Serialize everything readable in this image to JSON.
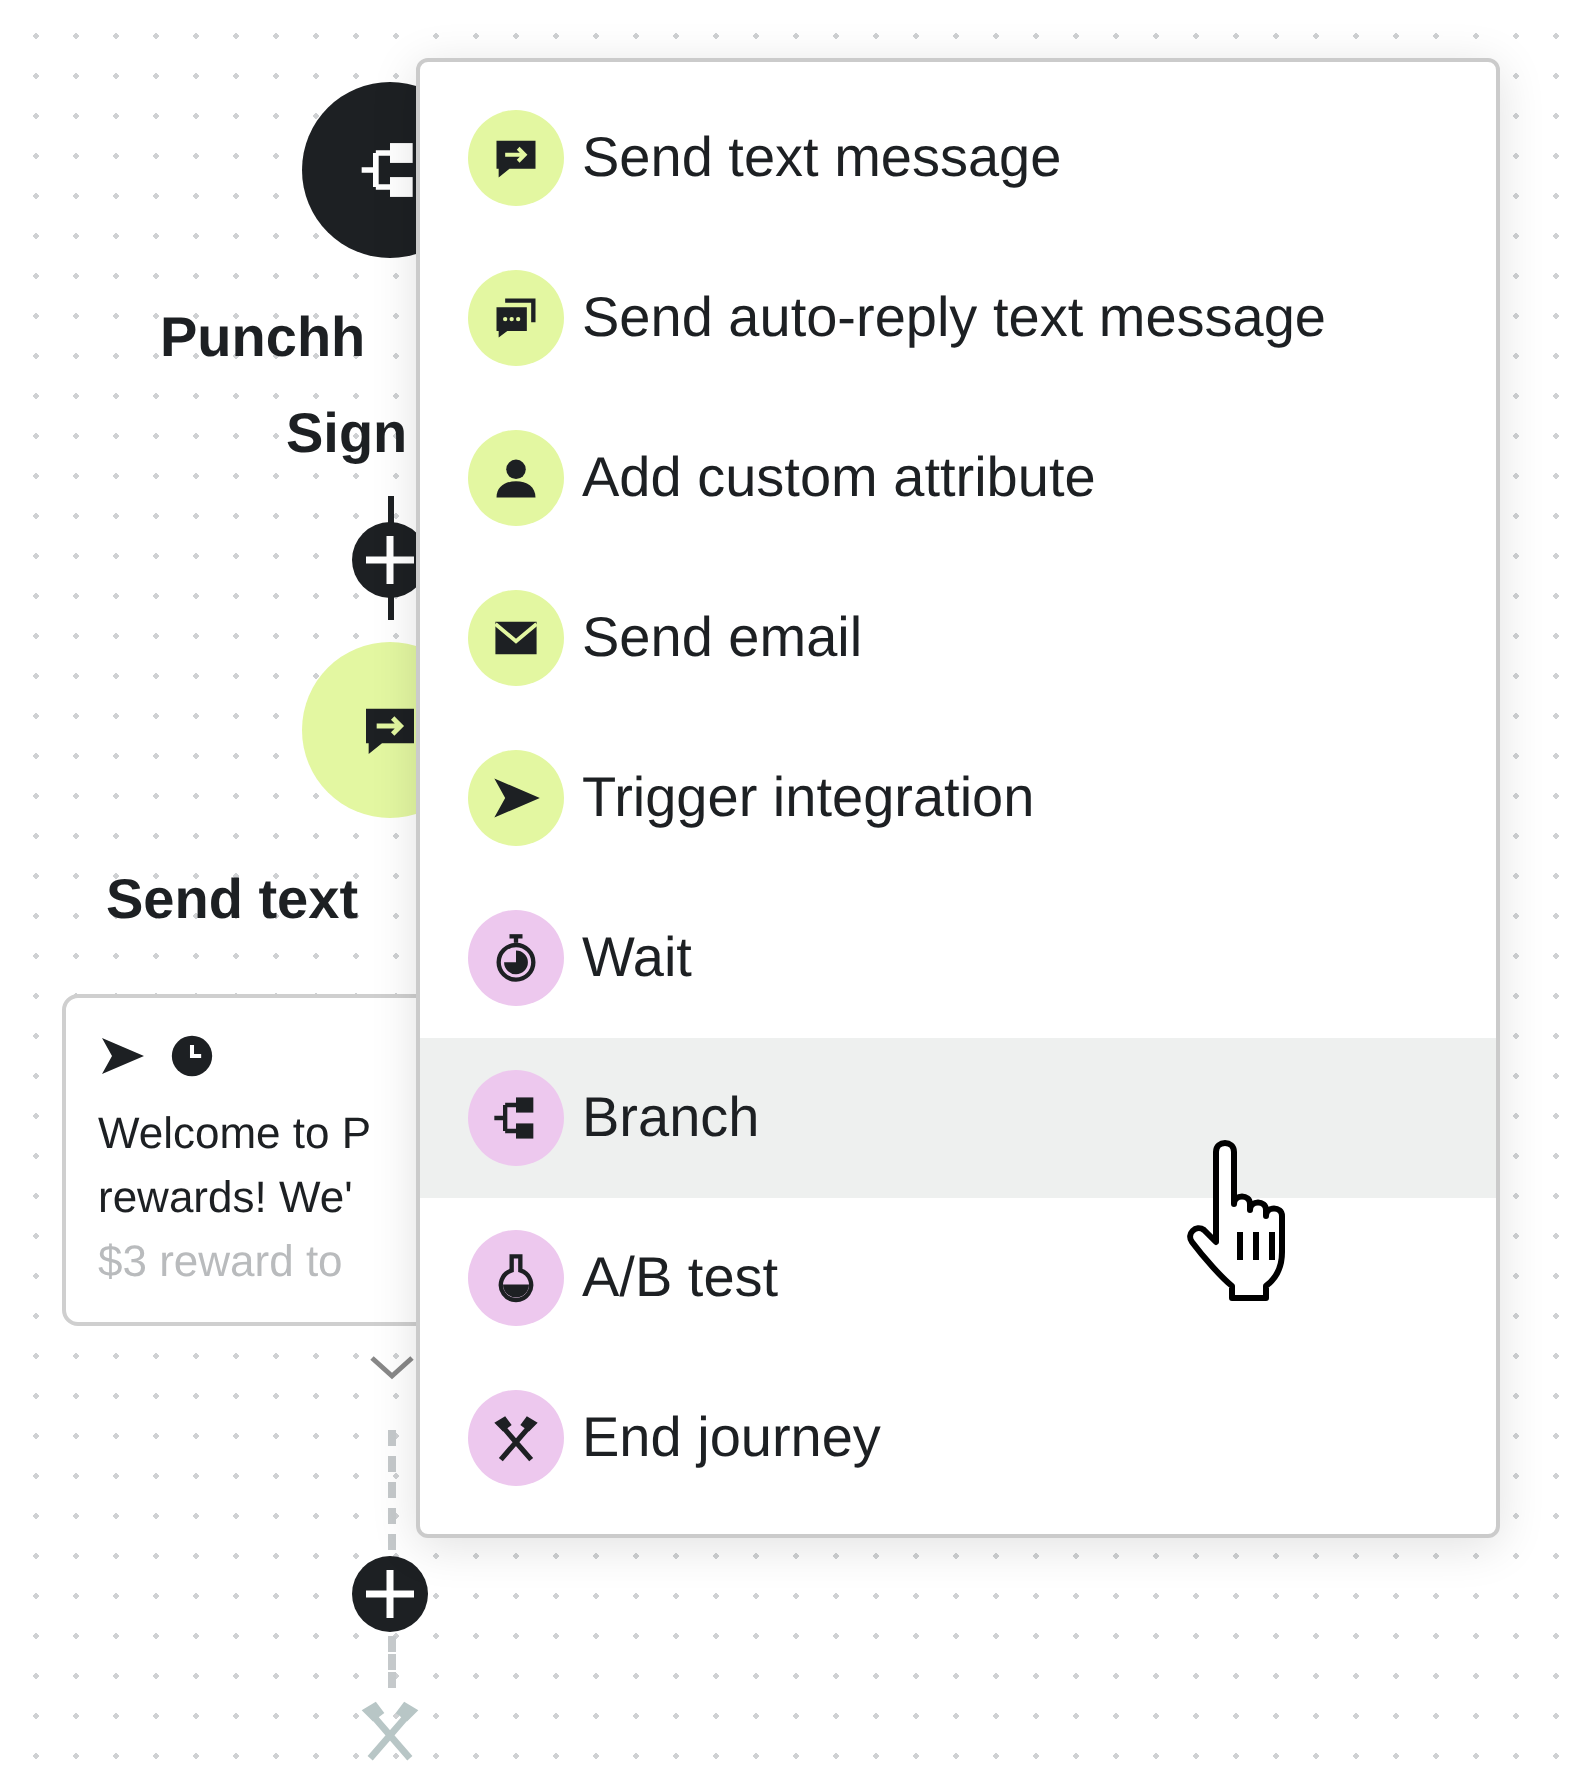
{
  "trigger_node": {
    "title_lines": [
      "Punchh",
      "Sign"
    ]
  },
  "action_node": {
    "title": "Send text",
    "message_lines": [
      "Welcome to P",
      "rewards! We'",
      "$3 reward to"
    ]
  },
  "menu": {
    "items": [
      {
        "label": "Send text message",
        "kind": "sms",
        "color": "#e3f7a1",
        "selected": false
      },
      {
        "label": "Send auto-reply text message",
        "kind": "auto-reply",
        "color": "#e3f7a1",
        "selected": false
      },
      {
        "label": "Add custom attribute",
        "kind": "attribute",
        "color": "#e3f7a1",
        "selected": false
      },
      {
        "label": "Send email",
        "kind": "email",
        "color": "#e3f7a1",
        "selected": false
      },
      {
        "label": "Trigger integration",
        "kind": "integration",
        "color": "#e3f7a1",
        "selected": false
      },
      {
        "label": "Wait",
        "kind": "wait",
        "color": "#edc8ee",
        "selected": false
      },
      {
        "label": "Branch",
        "kind": "branch",
        "color": "#edc8ee",
        "selected": true
      },
      {
        "label": "A/B test",
        "kind": "abtest",
        "color": "#edc8ee",
        "selected": false
      },
      {
        "label": "End journey",
        "kind": "end",
        "color": "#edc8ee",
        "selected": false
      }
    ]
  }
}
